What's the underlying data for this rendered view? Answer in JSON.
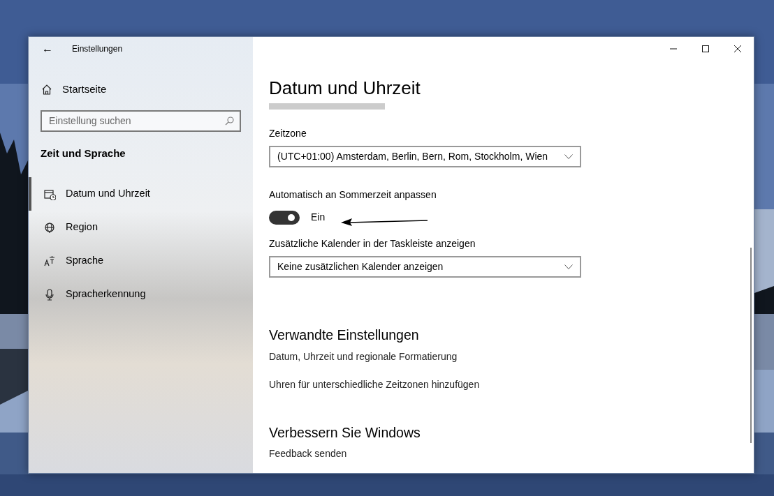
{
  "window": {
    "title": "Einstellungen",
    "back": "←"
  },
  "sidebar": {
    "home": "Startseite",
    "search": {
      "placeholder": "Einstellung suchen"
    },
    "section": "Zeit und Sprache",
    "items": [
      {
        "label": "Datum und Uhrzeit",
        "selected": true
      },
      {
        "label": "Region",
        "selected": false
      },
      {
        "label": "Sprache",
        "selected": false
      },
      {
        "label": "Spracherkennung",
        "selected": false
      }
    ]
  },
  "page": {
    "title": "Datum und Uhrzeit",
    "timezone": {
      "label": "Zeitzone",
      "value": "(UTC+01:00) Amsterdam, Berlin, Bern, Rom, Stockholm, Wien"
    },
    "dst": {
      "label": "Automatisch an Sommerzeit anpassen",
      "on": true,
      "state": "Ein"
    },
    "calendar": {
      "label": "Zusätzliche Kalender in der Taskleiste anzeigen",
      "value": "Keine zusätzlichen Kalender anzeigen"
    },
    "sections": [
      {
        "heading": "Verwandte Einstellungen",
        "links": [
          "Datum, Uhrzeit und regionale Formatierung",
          "Uhren für unterschiedliche Zeitzonen hinzufügen"
        ]
      },
      {
        "heading": "Verbessern Sie Windows",
        "links": [
          "Feedback senden"
        ]
      }
    ]
  }
}
